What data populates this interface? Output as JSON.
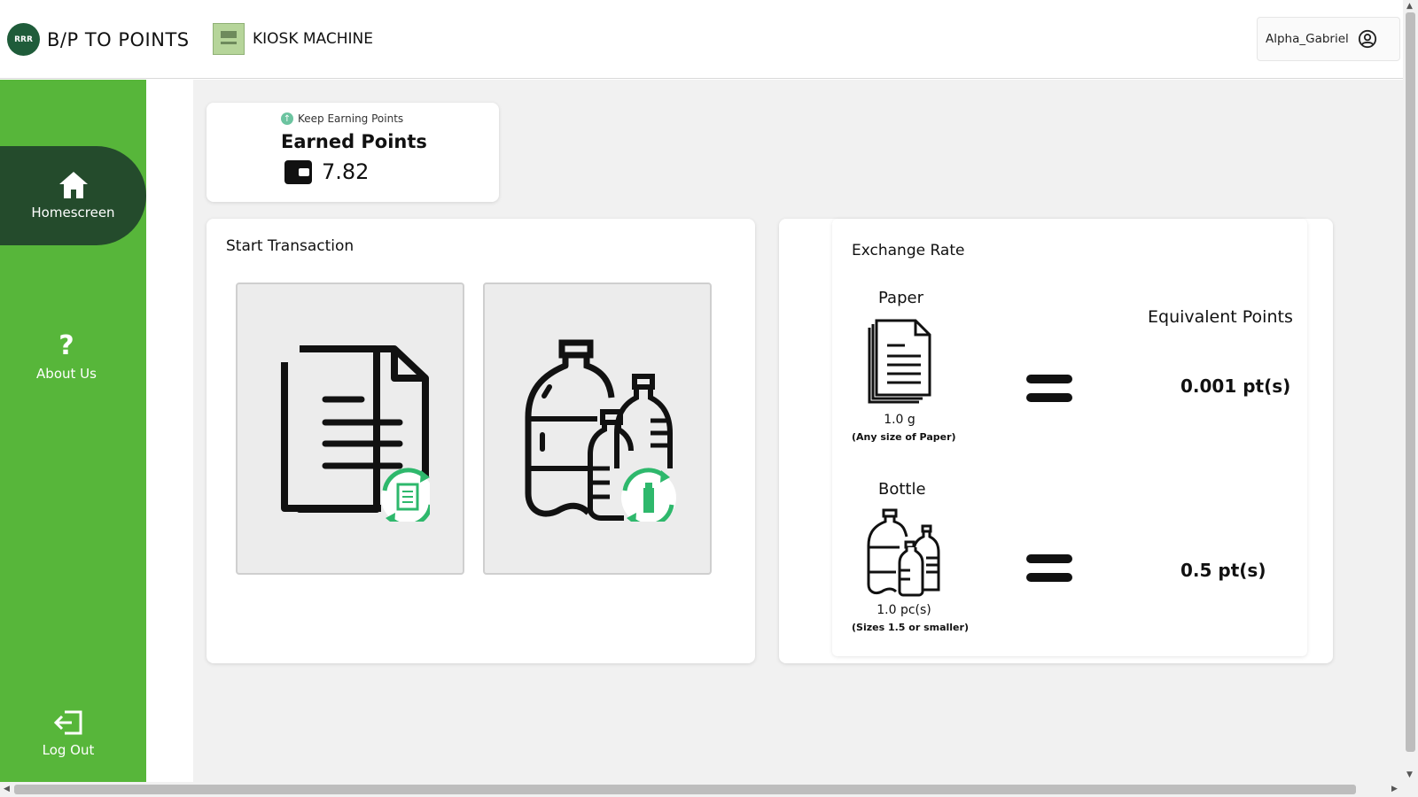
{
  "header": {
    "brand_logo_text": "RRR",
    "brand_title": "B/P TO POINTS",
    "kiosk_title": "KIOSK MACHINE",
    "username": "Alpha_Gabriel"
  },
  "sidebar": {
    "items": [
      {
        "label": "Homescreen",
        "icon": "home-icon",
        "active": true
      },
      {
        "label": "About Us",
        "icon": "question-icon"
      },
      {
        "label": "Log Out",
        "icon": "logout-icon"
      }
    ],
    "colors": {
      "background": "#57b63a",
      "active": "#244b2c"
    }
  },
  "earned": {
    "subtitle": "Keep Earning Points",
    "title": "Earned Points",
    "value": "7.82"
  },
  "transaction": {
    "title": "Start Transaction",
    "options": [
      {
        "name": "paper",
        "icon": "paper-recycle-icon"
      },
      {
        "name": "bottle",
        "icon": "bottle-recycle-icon"
      }
    ]
  },
  "exchange": {
    "title": "Exchange Rate",
    "equivalent_header": "Equivalent Points",
    "paper": {
      "label": "Paper",
      "qty": "1.0 g",
      "note": "(Any size of Paper)",
      "points": "0.001 pt(s)"
    },
    "bottle": {
      "label": "Bottle",
      "qty": "1.0 pc(s)",
      "note": "(Sizes 1.5 or smaller)",
      "points": "0.5 pt(s)"
    }
  },
  "colors": {
    "accent": "#57b63a",
    "recycle": "#2eb86c"
  }
}
